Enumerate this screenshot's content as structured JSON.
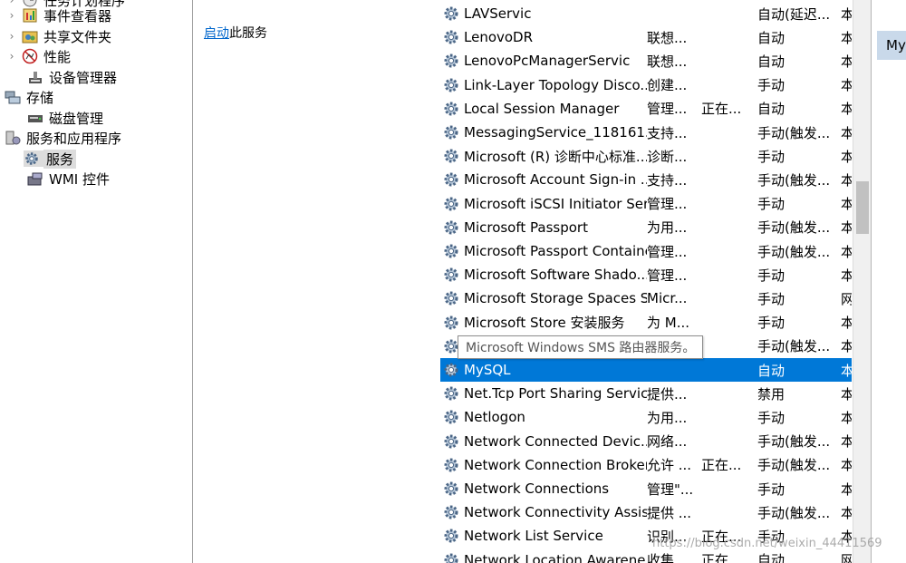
{
  "tree": {
    "items": [
      {
        "label": "任务计划程序",
        "icon": "task-scheduler-icon"
      },
      {
        "label": "事件查看器",
        "icon": "event-viewer-icon"
      },
      {
        "label": "共享文件夹",
        "icon": "shared-folders-icon"
      },
      {
        "label": "性能",
        "icon": "performance-icon"
      },
      {
        "label": "设备管理器",
        "icon": "device-manager-icon"
      },
      {
        "label": "存储",
        "icon": "storage-icon"
      },
      {
        "label": "磁盘管理",
        "icon": "disk-management-icon"
      },
      {
        "label": "服务和应用程序",
        "icon": "services-apps-icon"
      },
      {
        "label": "服务",
        "icon": "services-icon"
      },
      {
        "label": "WMI 控件",
        "icon": "wmi-control-icon"
      }
    ]
  },
  "extended": {
    "start_link": "启动",
    "start_suffix": "此服务"
  },
  "services": [
    {
      "name": "LAVServic",
      "desc": "",
      "status": "",
      "startup": "自动(延迟...",
      "logon": "本"
    },
    {
      "name": "LenovoDR",
      "desc": "联想...",
      "status": "",
      "startup": "自动",
      "logon": "本"
    },
    {
      "name": "LenovoPcManagerServic",
      "desc": "联想...",
      "status": "",
      "startup": "自动",
      "logon": "本"
    },
    {
      "name": "Link-Layer Topology Disco...",
      "desc": "创建...",
      "status": "",
      "startup": "手动",
      "logon": "本"
    },
    {
      "name": "Local Session Manager",
      "desc": "管理...",
      "status": "正在...",
      "startup": "自动",
      "logon": "本"
    },
    {
      "name": "MessagingService_118161...",
      "desc": "支持...",
      "status": "",
      "startup": "手动(触发...",
      "logon": "本"
    },
    {
      "name": "Microsoft (R) 诊断中心标准...",
      "desc": "诊断...",
      "status": "",
      "startup": "手动",
      "logon": "本"
    },
    {
      "name": "Microsoft Account Sign-in ...",
      "desc": "支持...",
      "status": "",
      "startup": "手动(触发...",
      "logon": "本"
    },
    {
      "name": "Microsoft iSCSI Initiator Ser...",
      "desc": "管理...",
      "status": "",
      "startup": "手动",
      "logon": "本"
    },
    {
      "name": "Microsoft Passport",
      "desc": "为用...",
      "status": "",
      "startup": "手动(触发...",
      "logon": "本"
    },
    {
      "name": "Microsoft Passport Container",
      "desc": "管理...",
      "status": "",
      "startup": "手动(触发...",
      "logon": "本"
    },
    {
      "name": "Microsoft Software Shado...",
      "desc": "管理...",
      "status": "",
      "startup": "手动",
      "logon": "本"
    },
    {
      "name": "Microsoft Storage Spaces S...",
      "desc": "Micr...",
      "status": "",
      "startup": "手动",
      "logon": "网"
    },
    {
      "name": "Microsoft Store 安装服务",
      "desc": "为 M...",
      "status": "",
      "startup": "手动",
      "logon": "本"
    },
    {
      "name": "",
      "desc": "",
      "status": "",
      "startup": "手动(触发...",
      "logon": "本"
    },
    {
      "name": "MySQL",
      "desc": "",
      "status": "",
      "startup": "自动",
      "logon": "本",
      "selected": true
    },
    {
      "name": "Net.Tcp Port Sharing Service",
      "desc": "提供...",
      "status": "",
      "startup": "禁用",
      "logon": "本"
    },
    {
      "name": "Netlogon",
      "desc": "为用...",
      "status": "",
      "startup": "手动",
      "logon": "本"
    },
    {
      "name": "Network Connected Devic...",
      "desc": "网络...",
      "status": "",
      "startup": "手动(触发...",
      "logon": "本"
    },
    {
      "name": "Network Connection Broker",
      "desc": "允许 ...",
      "status": "正在...",
      "startup": "手动(触发...",
      "logon": "本"
    },
    {
      "name": "Network Connections",
      "desc": "管理\"...",
      "status": "",
      "startup": "手动",
      "logon": "本"
    },
    {
      "name": "Network Connectivity Assis...",
      "desc": "提供 ...",
      "status": "",
      "startup": "手动(触发...",
      "logon": "本"
    },
    {
      "name": "Network List Service",
      "desc": "识别...",
      "status": "正在...",
      "startup": "手动",
      "logon": "本"
    },
    {
      "name": "Network Location Awarene...",
      "desc": "收集...",
      "status": "正在...",
      "startup": "自动",
      "logon": "网"
    }
  ],
  "tooltip": "Microsoft Windows SMS 路由器服务。",
  "action_tab": "My",
  "watermark": "https://blog.csdn.net/weixin_44411569",
  "colors": {
    "selection": "#0078d7",
    "link": "#0066cc"
  }
}
